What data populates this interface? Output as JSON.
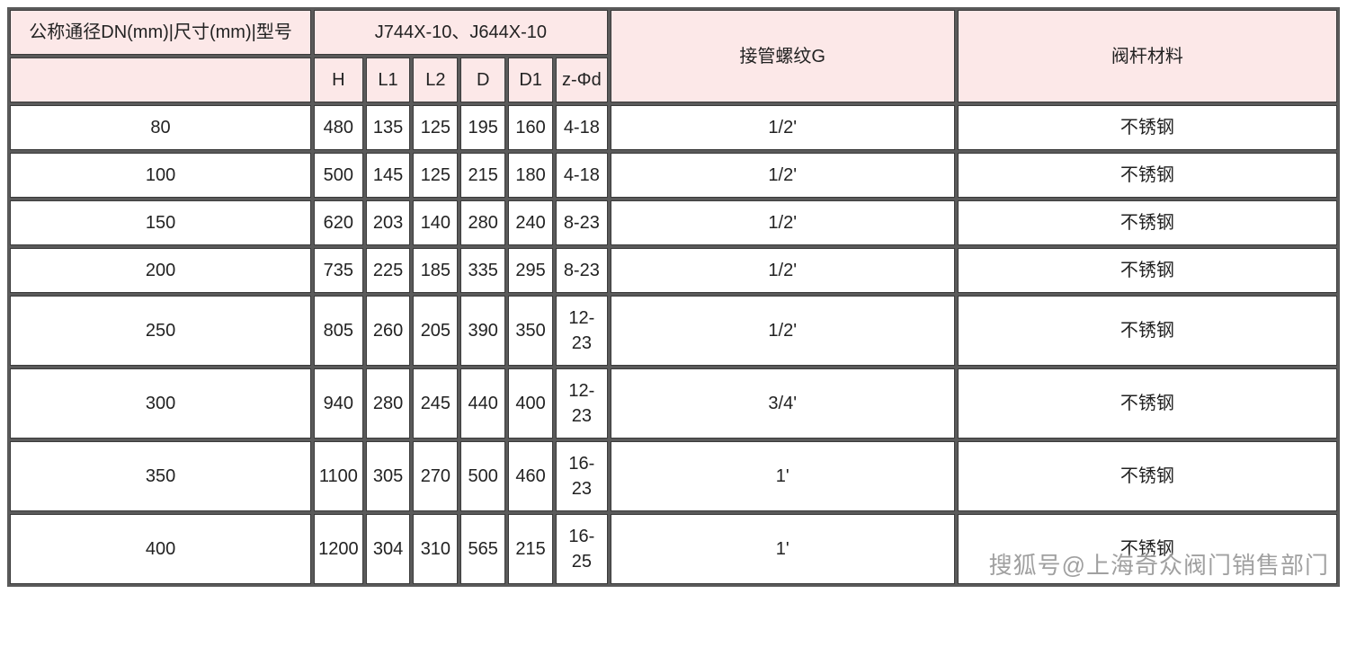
{
  "headers": {
    "dn": "公称通径DN(mm)|尺寸(mm)|型号",
    "model_group": "J744X-10、J644X-10",
    "sub": [
      "H",
      "L1",
      "L2",
      "D",
      "D1",
      "z-Φd"
    ],
    "thread": "接管螺纹G",
    "material": "阀杆材料"
  },
  "rows": [
    {
      "dn": "80",
      "H": "480",
      "L1": "135",
      "L2": "125",
      "D": "195",
      "D1": "160",
      "zphi": "4-18",
      "g": "1/2'",
      "mat": "不锈钢"
    },
    {
      "dn": "100",
      "H": "500",
      "L1": "145",
      "L2": "125",
      "D": "215",
      "D1": "180",
      "zphi": "4-18",
      "g": "1/2'",
      "mat": "不锈钢"
    },
    {
      "dn": "150",
      "H": "620",
      "L1": "203",
      "L2": "140",
      "D": "280",
      "D1": "240",
      "zphi": "8-23",
      "g": "1/2'",
      "mat": "不锈钢"
    },
    {
      "dn": "200",
      "H": "735",
      "L1": "225",
      "L2": "185",
      "D": "335",
      "D1": "295",
      "zphi": "8-23",
      "g": "1/2'",
      "mat": "不锈钢"
    },
    {
      "dn": "250",
      "H": "805",
      "L1": "260",
      "L2": "205",
      "D": "390",
      "D1": "350",
      "zphi": "12-23",
      "g": "1/2'",
      "mat": "不锈钢"
    },
    {
      "dn": "300",
      "H": "940",
      "L1": "280",
      "L2": "245",
      "D": "440",
      "D1": "400",
      "zphi": "12-23",
      "g": "3/4'",
      "mat": "不锈钢"
    },
    {
      "dn": "350",
      "H": "1100",
      "L1": "305",
      "L2": "270",
      "D": "500",
      "D1": "460",
      "zphi": "16-23",
      "g": "1'",
      "mat": "不锈钢"
    },
    {
      "dn": "400",
      "H": "1200",
      "L1": "304",
      "L2": "310",
      "D": "565",
      "D1": "215",
      "zphi": "16-25",
      "g": "1'",
      "mat": "不锈钢"
    }
  ],
  "watermark": "搜狐号@上海奇众阀门销售部门"
}
